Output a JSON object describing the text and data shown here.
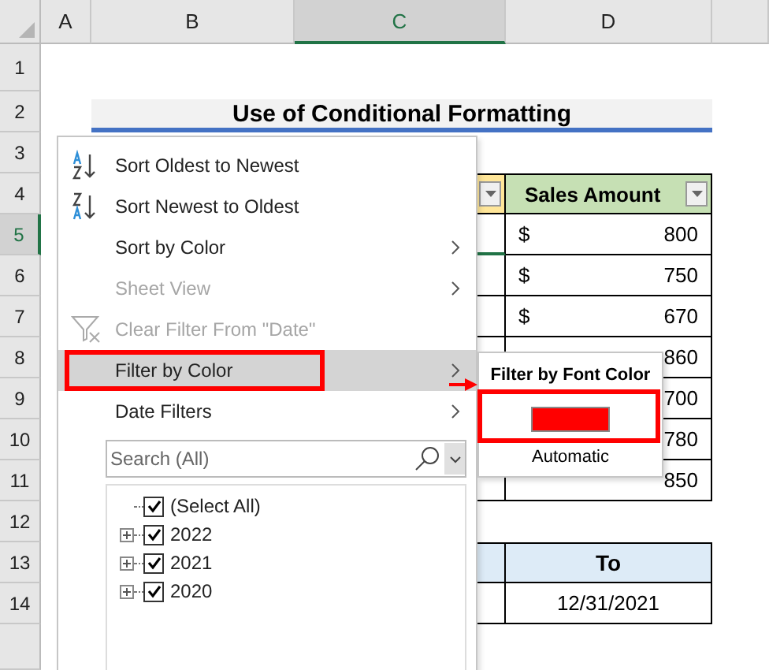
{
  "columns": [
    {
      "label": "A",
      "selected": false
    },
    {
      "label": "B",
      "selected": false
    },
    {
      "label": "C",
      "selected": true
    },
    {
      "label": "D",
      "selected": false
    }
  ],
  "rows": [
    {
      "label": "1",
      "selected": false
    },
    {
      "label": "2",
      "selected": false
    },
    {
      "label": "3",
      "selected": false
    },
    {
      "label": "4",
      "selected": false
    },
    {
      "label": "5",
      "selected": true
    },
    {
      "label": "6",
      "selected": false
    },
    {
      "label": "7",
      "selected": false
    },
    {
      "label": "8",
      "selected": false
    },
    {
      "label": "9",
      "selected": false
    },
    {
      "label": "10",
      "selected": false
    },
    {
      "label": "11",
      "selected": false
    },
    {
      "label": "12",
      "selected": false
    },
    {
      "label": "13",
      "selected": false
    },
    {
      "label": "14",
      "selected": false
    }
  ],
  "title": "Use of Conditional Formatting",
  "sales_table": {
    "header": "Sales Amount",
    "rows": [
      {
        "currency": "$",
        "amount": "800"
      },
      {
        "currency": "$",
        "amount": "750"
      },
      {
        "currency": "$",
        "amount": "670"
      },
      {
        "amount": "860"
      },
      {
        "amount": "700"
      },
      {
        "amount": "780"
      },
      {
        "amount": "850"
      }
    ]
  },
  "date_table": {
    "header": "To",
    "value": "12/31/2021"
  },
  "filter_menu": {
    "items": [
      {
        "kind": "sort_asc",
        "label": "Sort Oldest to Newest",
        "disabled": false,
        "highlighted": false,
        "submenu": false
      },
      {
        "kind": "sort_desc",
        "label": "Sort Newest to Oldest",
        "disabled": false,
        "highlighted": false,
        "submenu": false
      },
      {
        "kind": "plain",
        "label": "Sort by Color",
        "disabled": false,
        "highlighted": false,
        "submenu": true
      },
      {
        "kind": "plain",
        "label": "Sheet View",
        "disabled": true,
        "highlighted": false,
        "submenu": true
      },
      {
        "kind": "clear",
        "label": "Clear Filter From \"Date\"",
        "disabled": true,
        "highlighted": false,
        "submenu": false
      },
      {
        "kind": "plain",
        "label": "Filter by Color",
        "disabled": false,
        "highlighted": true,
        "submenu": true
      },
      {
        "kind": "plain",
        "label": "Date Filters",
        "disabled": false,
        "highlighted": false,
        "submenu": true
      }
    ],
    "search": {
      "placeholder": "Search (All)"
    },
    "tree": [
      {
        "label": "(Select All)",
        "checked": true,
        "expandable": false
      },
      {
        "label": "2022",
        "checked": true,
        "expandable": true
      },
      {
        "label": "2021",
        "checked": true,
        "expandable": true
      },
      {
        "label": "2020",
        "checked": true,
        "expandable": true
      }
    ]
  },
  "submenu": {
    "title": "Filter by Font Color",
    "swatch": {
      "color": "#ff0000"
    },
    "option": "Automatic"
  }
}
